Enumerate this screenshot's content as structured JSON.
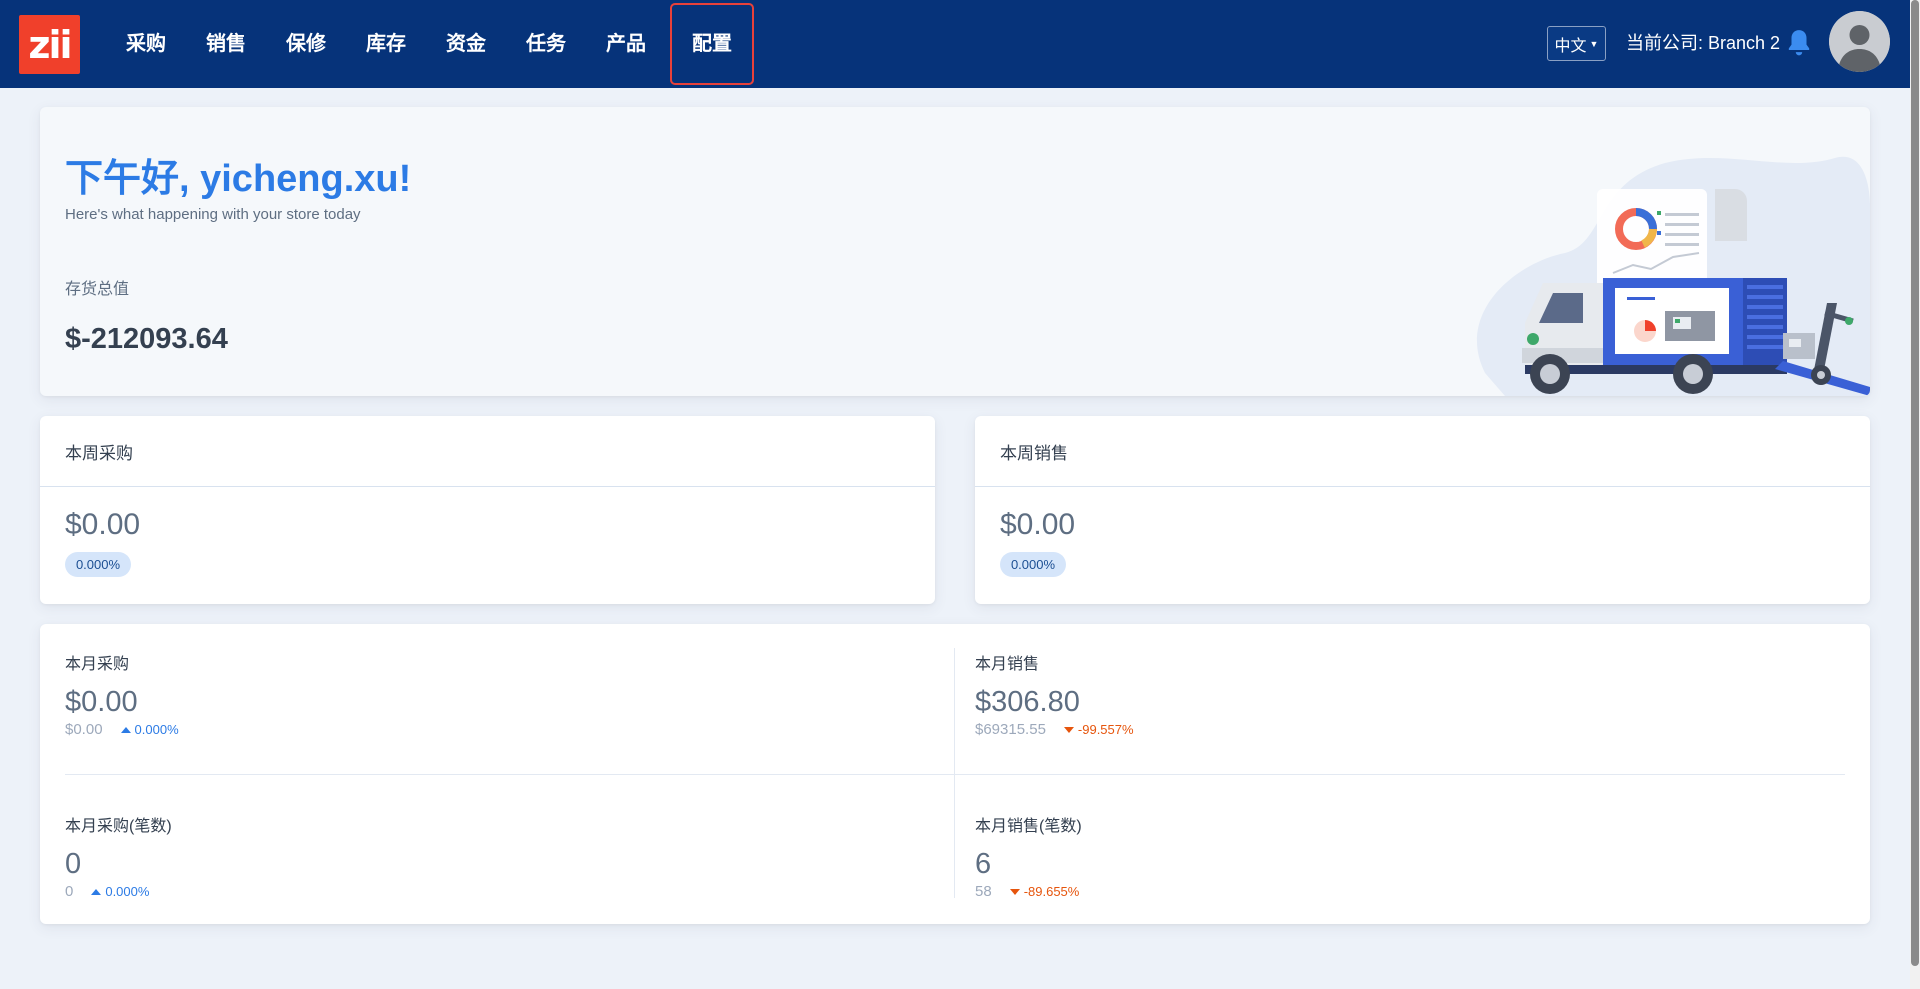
{
  "nav": {
    "logo_text": "zii",
    "items": [
      "采购",
      "销售",
      "保修",
      "库存",
      "资金",
      "任务",
      "产品",
      "配置"
    ],
    "language": "中文",
    "company": "当前公司: Branch 2"
  },
  "hero": {
    "greeting": "下午好, yicheng.xu!",
    "subtitle": "Here's what happening with your store today",
    "inventory_label": "存货总值",
    "inventory_value": "$-212093.64"
  },
  "week_purchase": {
    "label": "本周采购",
    "value": "$0.00",
    "badge": "0.000%"
  },
  "week_sales": {
    "label": "本周销售",
    "value": "$0.00",
    "badge": "0.000%"
  },
  "month": {
    "purchase": {
      "label": "本月采购",
      "value": "$0.00",
      "previous": "$0.00",
      "trend": "0.000%"
    },
    "sales": {
      "label": "本月销售",
      "value": "$306.80",
      "previous": "$69315.55",
      "trend": "-99.557%"
    },
    "purchase_count": {
      "label": "本月采购(笔数)",
      "value": "0",
      "previous": "0",
      "trend": "0.000%"
    },
    "sales_count": {
      "label": "本月销售(笔数)",
      "value": "6",
      "previous": "58",
      "trend": "-89.655%"
    }
  },
  "colors": {
    "navbar": "#06337a",
    "accent": "#2c7be5",
    "logo": "#f0402b",
    "trend_down": "#e6550d"
  }
}
